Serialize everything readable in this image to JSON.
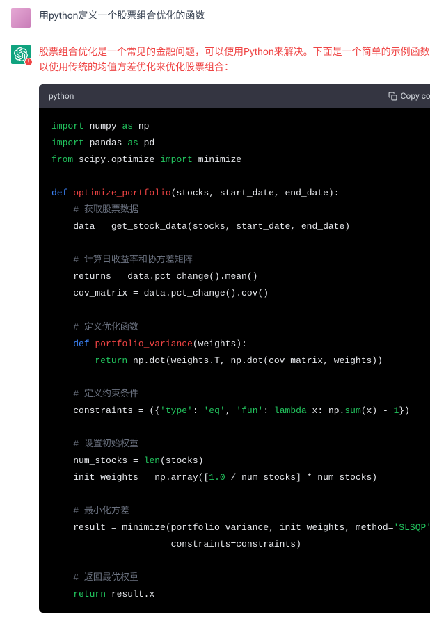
{
  "user": {
    "message": "用python定义一个股票组合优化的函数"
  },
  "assistant": {
    "intro": "股票组合优化是一个常见的金融问题，可以使用Python来解决。下面是一个简单的示例函数，可以使用传统的均值方差优化来优化股票组合："
  },
  "code": {
    "language": "python",
    "copy_label": "Copy code",
    "lines": {
      "l1a": "import",
      "l1b": "numpy",
      "l1c": "as",
      "l1d": "np",
      "l2a": "import",
      "l2b": "pandas",
      "l2c": "as",
      "l2d": "pd",
      "l3a": "from",
      "l3b": "scipy.optimize",
      "l3c": "import",
      "l3d": "minimize",
      "l5a": "def",
      "l5b": "optimize_portfolio",
      "l5c": "(stocks, start_date, end_date)",
      "l6": "# 获取股票数据",
      "l7a": "data = get_stock_data(stocks, start_date, end_date)",
      "l9": "# 计算日收益率和协方差矩阵",
      "l10": "returns = data.pct_change().mean()",
      "l11": "cov_matrix = data.pct_change().cov()",
      "l13": "# 定义优化函数",
      "l14a": "def",
      "l14b": "portfolio_variance",
      "l14c": "(weights)",
      "l15a": "return",
      "l15b": "np.dot(weights.T, np.dot(cov_matrix, weights))",
      "l17": "# 定义约束条件",
      "l18a": "constraints = ({",
      "l18b": "'type'",
      "l18c": ": ",
      "l18d": "'eq'",
      "l18e": ", ",
      "l18f": "'fun'",
      "l18g": ": ",
      "l18h": "lambda",
      "l18i": " x: np.",
      "l18j": "sum",
      "l18k": "(x) - ",
      "l18l": "1",
      "l18m": "})",
      "l20": "# 设置初始权重",
      "l21a": "num_stocks = ",
      "l21b": "len",
      "l21c": "(stocks)",
      "l22a": "init_weights = np.array([",
      "l22b": "1.0",
      "l22c": " / num_stocks] * num_stocks)",
      "l24": "# 最小化方差",
      "l25a": "result = minimize(portfolio_variance, init_weights, method=",
      "l25b": "'SLSQP'",
      "l25c": ",",
      "l26": "constraints=constraints)",
      "l28": "# 返回最优权重",
      "l29a": "return",
      "l29b": "result.x"
    }
  }
}
